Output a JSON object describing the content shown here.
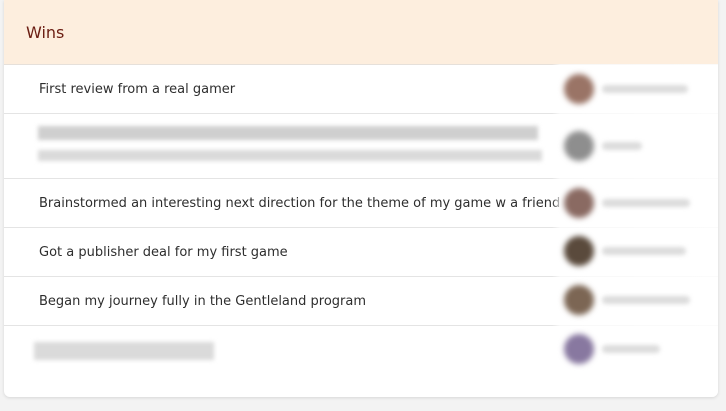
{
  "header": {
    "title": "Wins"
  },
  "rows": [
    {
      "text": "First review from a real gamer"
    },
    {
      "text": ""
    },
    {
      "text": "Brainstormed an interesting next direction for the theme of my game w a friend"
    },
    {
      "text": "Got a publisher deal for my first game"
    },
    {
      "text": "Began my journey fully in the Gentleland program"
    },
    {
      "text": ""
    }
  ],
  "avatars": [
    {
      "color": "#9a7466"
    },
    {
      "color": "#8e8e8e"
    },
    {
      "color": "#8a6a62"
    },
    {
      "color": "#5a4a3c"
    },
    {
      "color": "#7c6654"
    },
    {
      "color": "#8878a0"
    }
  ]
}
